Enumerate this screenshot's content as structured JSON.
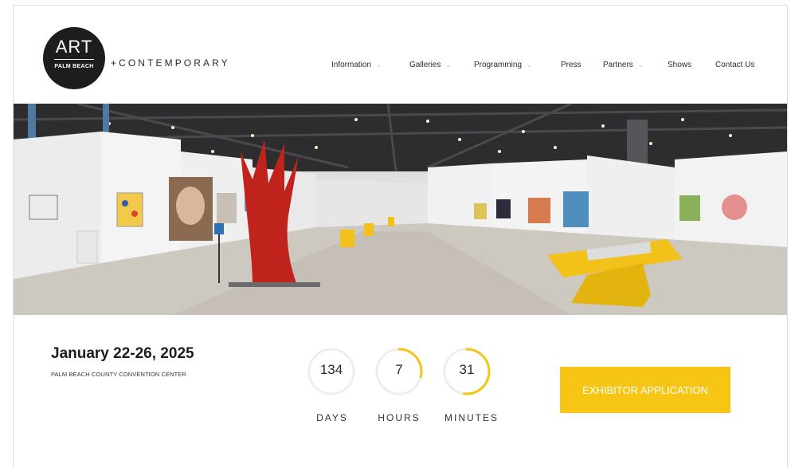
{
  "brand": {
    "logo_top": "ART",
    "logo_sub": "PALM BEACH",
    "logo_suffix": "+CONTEMPORARY"
  },
  "nav": {
    "items": [
      {
        "label": "Information",
        "dropdown": true
      },
      {
        "label": "Galleries",
        "dropdown": true
      },
      {
        "label": "Programming",
        "dropdown": true
      },
      {
        "label": "Press",
        "dropdown": false
      },
      {
        "label": "Partners",
        "dropdown": true
      },
      {
        "label": "Shows",
        "dropdown": false
      },
      {
        "label": "Contact Us",
        "dropdown": false
      }
    ],
    "chevron": "⌄"
  },
  "event": {
    "dates": "January 22-26, 2025",
    "venue": "PALM BEACH COUNTY CONVENTION CENTER"
  },
  "countdown": [
    {
      "value": "134",
      "label": "DAYS",
      "fraction": 0.0
    },
    {
      "value": "7",
      "label": "HOURS",
      "fraction": 0.29
    },
    {
      "value": "31",
      "label": "MINUTES",
      "fraction": 0.52
    }
  ],
  "cta": {
    "label": "EXHIBITOR APPLICATION"
  },
  "colors": {
    "accent": "#f7c514",
    "logo_bg": "#1f1c1c",
    "sculpture": "#c0231c"
  }
}
